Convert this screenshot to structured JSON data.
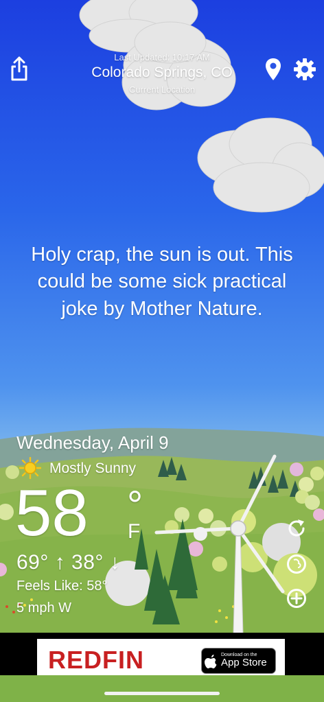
{
  "header": {
    "last_updated": "Last Updated: 10:17 AM",
    "city": "Colorado Springs, CO",
    "location_label": "Current Location",
    "share_icon": "share-icon",
    "location_icon": "map-pin-icon",
    "settings_icon": "gear-icon"
  },
  "quote": "Holy crap, the sun is out. This could be some sick practical joke by Mother Nature.",
  "weather": {
    "date": "Wednesday, April 9",
    "condition_icon": "sun-icon",
    "condition": "Mostly Sunny",
    "temperature": "58",
    "degree_symbol": "°",
    "unit": "F",
    "hi_lo": "69° ↑  38° ↓",
    "feels_like": "Feels Like: 58°",
    "wind": "5 mph W"
  },
  "side_actions": {
    "refresh_icon": "refresh-icon",
    "radar_icon": "radar-icon",
    "add_icon": "add-circle-icon"
  },
  "ad": {
    "brand": "REDFIN",
    "store_small": "Download on the",
    "store_big": "App Store"
  },
  "colors": {
    "sky_top": "#1c3fe0",
    "sky_bottom": "#a9cde8",
    "grass": "#7fb248",
    "ad_brand": "#c82021"
  }
}
